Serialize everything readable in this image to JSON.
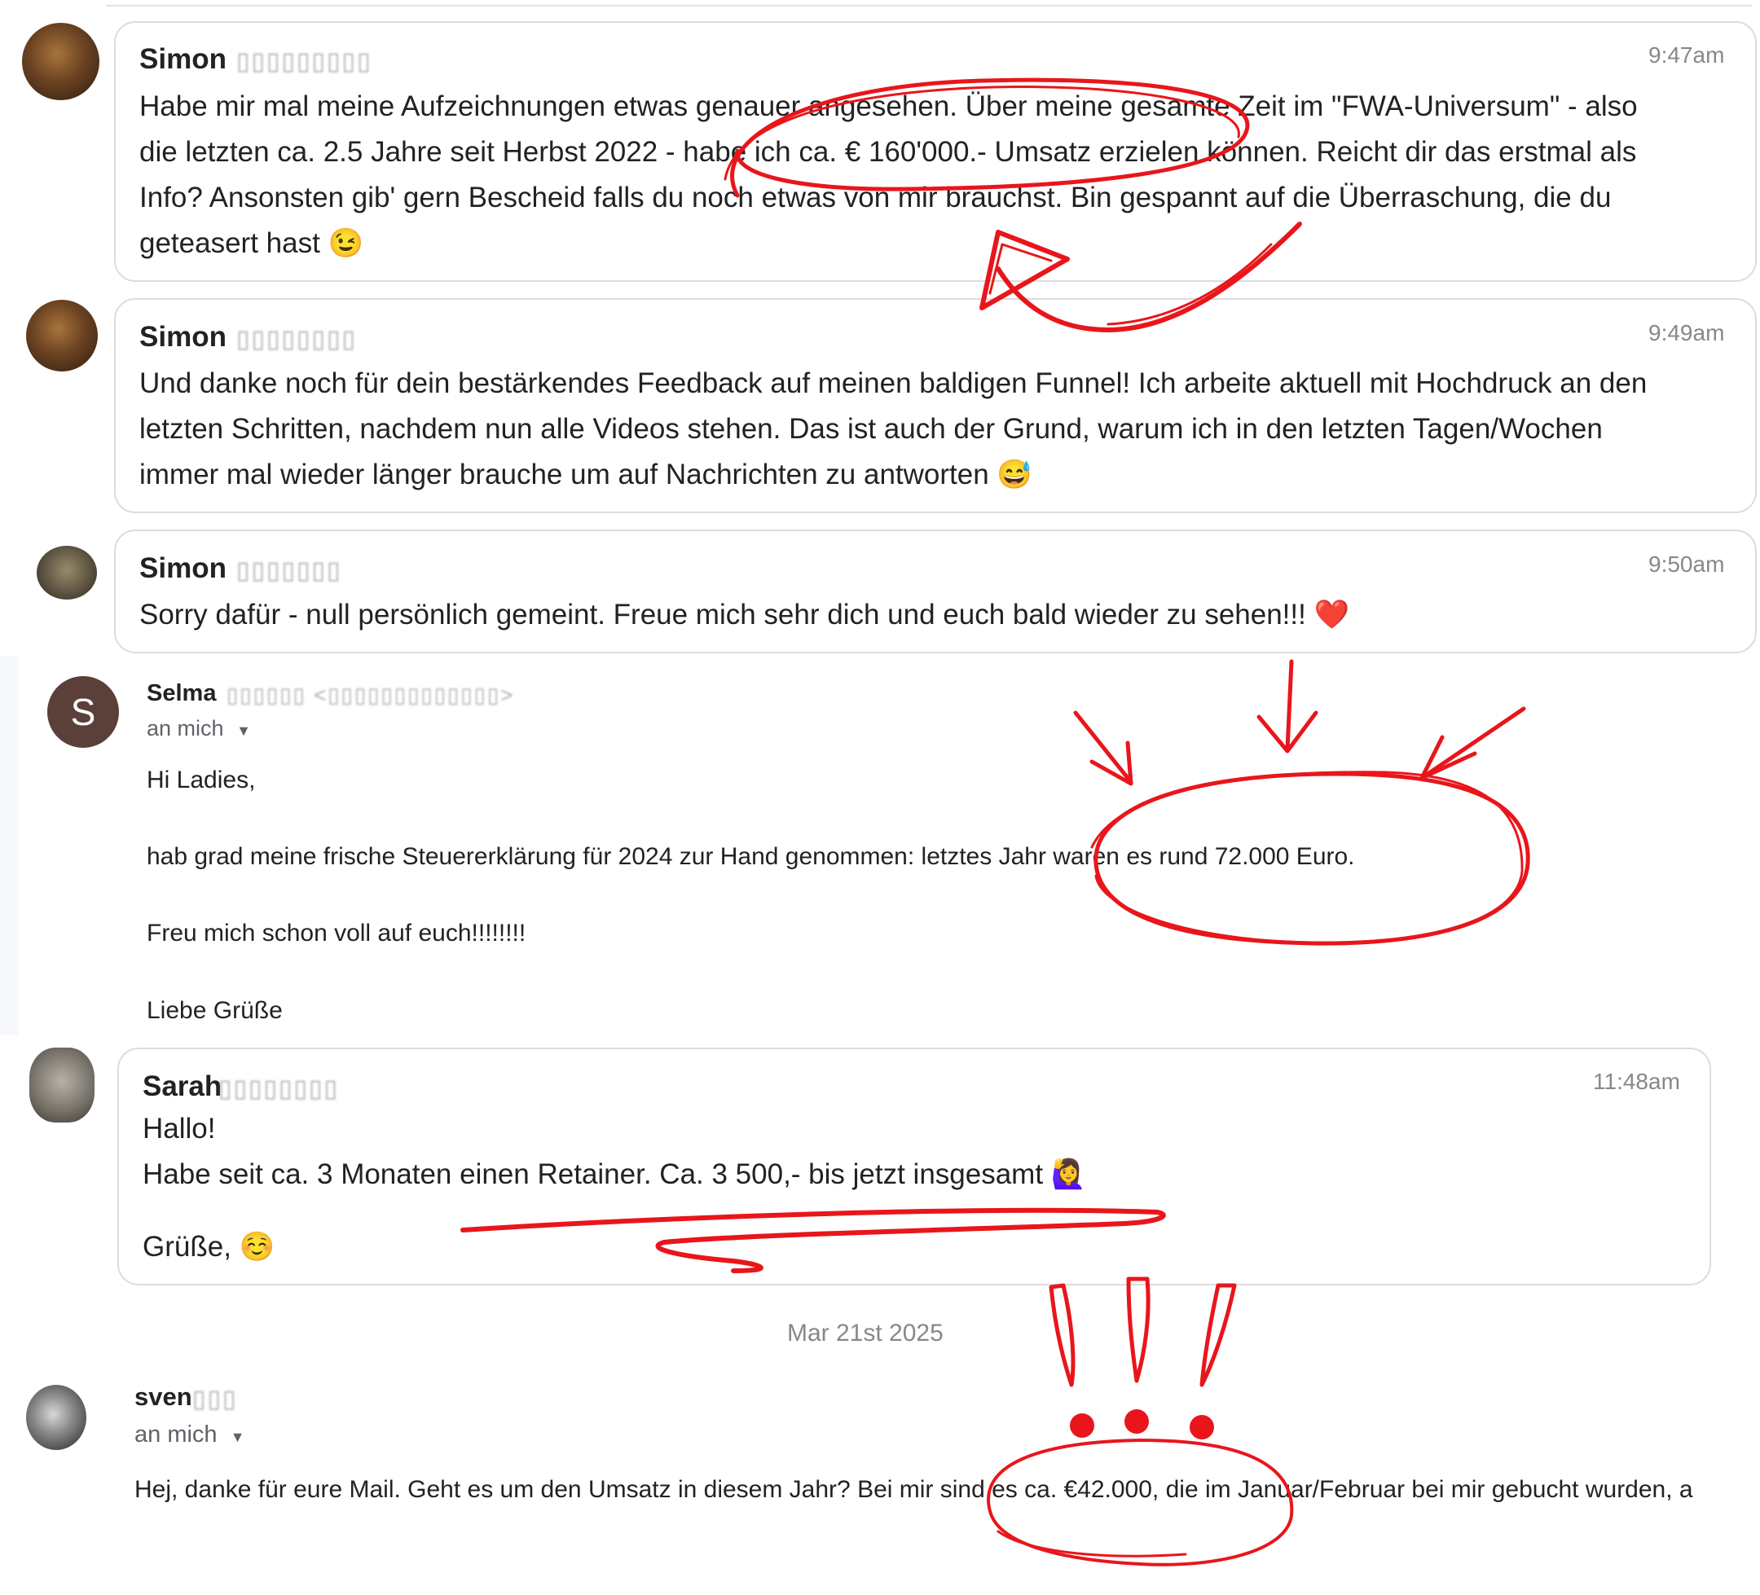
{
  "messages": [
    {
      "sender": "Simon",
      "time": "9:47am",
      "lines": [
        "Habe mir mal meine Aufzeichnungen etwas genauer angesehen. Über meine gesamte Zeit im \"FWA-Universum\" - also",
        "die letzten ca. 2.5 Jahre seit Herbst 2022 - habe ich ca. € 160'000.- Umsatz erzielen können. Reicht dir das erstmal als",
        "Info? Ansonsten gib' gern Bescheid falls du noch etwas von mir brauchst. Bin gespannt auf die Überraschung, die du",
        "geteasert hast 😉"
      ]
    },
    {
      "sender": "Simon",
      "time": "9:49am",
      "lines": [
        "Und danke noch für dein bestärkendes Feedback auf meinen baldigen Funnel! Ich arbeite aktuell mit Hochdruck an den",
        "letzten Schritten, nachdem nun alle Videos stehen. Das ist auch der Grund, warum ich in den letzten Tagen/Wochen",
        "immer mal wieder länger brauche um auf Nachrichten zu antworten 😅"
      ]
    },
    {
      "sender": "Simon",
      "time": "9:50am",
      "lines": [
        "Sorry dafür - null persönlich gemeint. Freue mich sehr dich und euch bald wieder zu sehen!!! ❤️"
      ]
    }
  ],
  "email1": {
    "avatar_letter": "S",
    "sender": "Selma",
    "to": "an mich",
    "greeting": "Hi Ladies,",
    "body": "hab grad meine frische Steuererklärung für 2024 zur Hand genommen: letztes Jahr waren es rund 72.000 Euro.",
    "line2": "Freu mich schon voll auf euch!!!!!!!!",
    "signoff": "Liebe Grüße"
  },
  "sarah": {
    "sender": "Sarah",
    "time": "11:48am",
    "lines": [
      "Hallo!",
      "Habe seit ca. 3 Monaten einen Retainer. Ca. 3 500,- bis jetzt insgesamt 🙋‍♀️"
    ],
    "signoff": "Grüße, ☺️"
  },
  "date_separator": "Mar 21st 2025",
  "email2": {
    "sender": "sven",
    "to": "an mich",
    "body": "Hej, danke für eure Mail. Geht es um den Umsatz in diesem Jahr? Bei mir sind es ca. €42.000, die im Januar/Februar bei mir gebucht wurden, a"
  },
  "colors": {
    "annotation": "#e8161b",
    "bubble_border": "#dcdcdc",
    "selma_avatar": "#5b3f39"
  }
}
